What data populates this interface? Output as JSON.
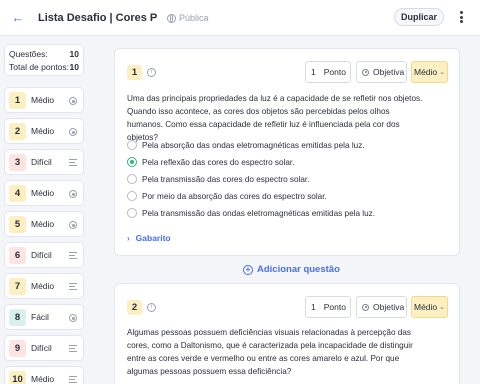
{
  "header": {
    "back_icon": "arrow-left-icon",
    "title": "Lista Desafio | Cores Primárias",
    "visibility": "Pública",
    "duplicate_label": "Duplicar",
    "more_icon": "more-vertical-icon",
    "accent": "#4a6cf7"
  },
  "summary": {
    "questions_label": "Questões:",
    "questions_value": "10",
    "points_label": "Total de pontos:",
    "points_value": "10"
  },
  "sidebar": {
    "items": [
      {
        "number": "1",
        "difficulty": "Médio",
        "icon": "radio-icon",
        "color": "#fcefc2"
      },
      {
        "number": "2",
        "difficulty": "Médio",
        "icon": "radio-icon",
        "color": "#fcefc2"
      },
      {
        "number": "3",
        "difficulty": "Difícil",
        "icon": "text-lines-icon",
        "color": "#fde3e1"
      },
      {
        "number": "4",
        "difficulty": "Médio",
        "icon": "radio-icon",
        "color": "#fcefc2"
      },
      {
        "number": "5",
        "difficulty": "Médio",
        "icon": "radio-icon",
        "color": "#fcefc2"
      },
      {
        "number": "6",
        "difficulty": "Difícil",
        "icon": "text-lines-icon",
        "color": "#fde3e1"
      },
      {
        "number": "7",
        "difficulty": "Médio",
        "icon": "text-lines-icon",
        "color": "#fcefc2"
      },
      {
        "number": "8",
        "difficulty": "Fácil",
        "icon": "radio-icon",
        "color": "#d9f1ea"
      },
      {
        "number": "9",
        "difficulty": "Difícil",
        "icon": "text-lines-icon",
        "color": "#fde3e1"
      },
      {
        "number": "10",
        "difficulty": "Médio",
        "icon": "text-lines-icon",
        "color": "#fcefc2"
      }
    ]
  },
  "questions": [
    {
      "number": "1",
      "points_value": "1",
      "points_label": "Ponto",
      "type_label": "Objetiva",
      "difficulty": "Médio",
      "text": "Uma das principais propriedades da luz é a capacidade de se refletir nos objetos. Quando isso acontece, as cores dos objetos são percebidas pelos olhos humanos. Como essa capacidade de refletir luz é influenciada pela cor dos objetos?",
      "options": [
        {
          "label": "Pela absorção das ondas eletromagnéticas emitidas pela luz.",
          "selected": false
        },
        {
          "label": "Pela reflexão das cores do espectro solar.",
          "selected": true
        },
        {
          "label": "Pela transmissão das cores do espectro solar.",
          "selected": false
        },
        {
          "label": "Por meio da absorção das cores do espectro solar.",
          "selected": false
        },
        {
          "label": "Pela transmissão das ondas eletromagnéticas emitidas pela luz.",
          "selected": false
        }
      ],
      "answer_key_label": "Gabarito"
    },
    {
      "number": "2",
      "points_value": "1",
      "points_label": "Ponto",
      "type_label": "Objetiva",
      "difficulty": "Médio",
      "text": "Algumas pessoas possuem deficiências visuais relacionadas à percepção das cores, como a Daltonismo, que é caracterizada pela incapacidade de distinguir entre as cores verde e vermelho ou entre as cores amarelo e azul. Por que algumas pessoas possuem essa deficiência?"
    }
  ],
  "add_question_label": "Adicionar questão"
}
